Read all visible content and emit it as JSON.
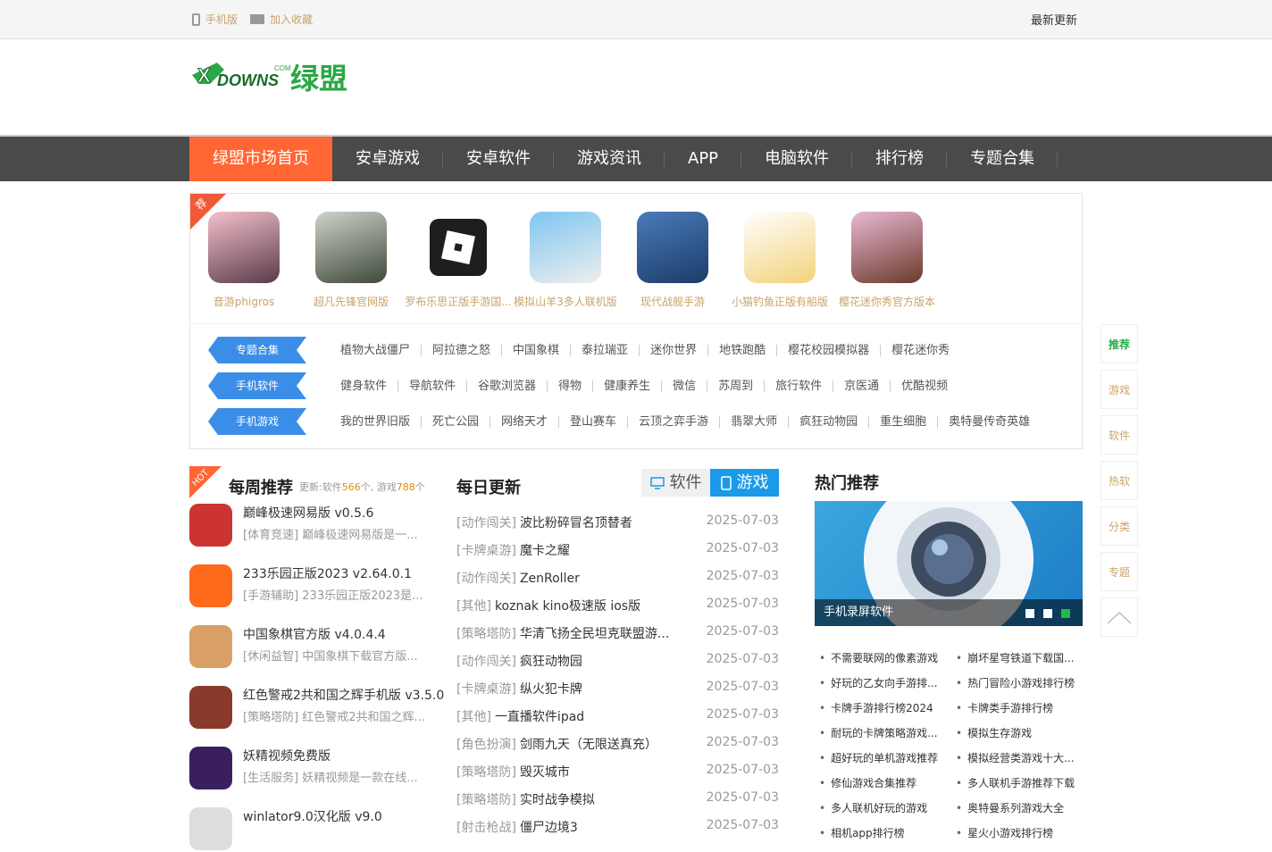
{
  "topbar": {
    "mobile": "手机版",
    "favorite": "加入收藏",
    "latest": "最新更新"
  },
  "logo": {
    "text": "XDOWNS绿盟",
    "com": "COM"
  },
  "nav": [
    "绿盟市场首页",
    "安卓游戏",
    "安卓软件",
    "游戏资讯",
    "APP",
    "电脑软件",
    "排行榜",
    "专题合集"
  ],
  "recommend": {
    "badge": "荐",
    "apps": [
      "音游phigros",
      "超凡先锋官网版",
      "罗布乐思正版手游国...",
      "模拟山羊3多人联机版",
      "现代战舰手游",
      "小猫钓鱼正版有船版",
      "樱花迷你秀官方版本"
    ]
  },
  "tags": [
    {
      "label": "专题合集",
      "links": [
        "植物大战僵尸",
        "阿拉德之怒",
        "中国象棋",
        "泰拉瑞亚",
        "迷你世界",
        "地铁跑酷",
        "樱花校园模拟器",
        "樱花迷你秀"
      ]
    },
    {
      "label": "手机软件",
      "links": [
        "健身软件",
        "导航软件",
        "谷歌浏览器",
        "得物",
        "健康养生",
        "微信",
        "苏周到",
        "旅行软件",
        "京医通",
        "优酷视频"
      ]
    },
    {
      "label": "手机游戏",
      "links": [
        "我的世界旧版",
        "死亡公园",
        "网络天才",
        "登山赛车",
        "云顶之弈手游",
        "翡翠大师",
        "疯狂动物园",
        "重生细胞",
        "奥特曼传奇英雄"
      ]
    }
  ],
  "weekly": {
    "hot": "HOT",
    "title": "每周推荐",
    "sub_prefix": "更新:软件",
    "soft_count": "566",
    "sub_mid": "个, 游戏",
    "game_count": "788",
    "sub_suffix": "个",
    "items": [
      {
        "title": "巅峰极速网易版 v0.5.6",
        "desc": "[体育竞速] 巅峰极速网易版是一..."
      },
      {
        "title": "233乐园正版2023 v2.64.0.1",
        "desc": "[手游辅助] 233乐园正版2023是..."
      },
      {
        "title": "中国象棋官方版 v4.0.4.4",
        "desc": "[休闲益智] 中国象棋下载官方版..."
      },
      {
        "title": "红色警戒2共和国之辉手机版 v3.5.0",
        "desc": "[策略塔防] 红色警戒2共和国之辉..."
      },
      {
        "title": "妖精视频免费版",
        "desc": "[生活服务] 妖精视频是一款在线..."
      },
      {
        "title": "winlator9.0汉化版 v9.0",
        "desc": ""
      }
    ]
  },
  "daily": {
    "title": "每日更新",
    "tabs": [
      "软件",
      "游戏"
    ],
    "rows": [
      {
        "cat": "[动作闯关]",
        "name": "波比粉碎冒名顶替者",
        "date": "2025-07-03"
      },
      {
        "cat": "[卡牌桌游]",
        "name": "魔卡之耀",
        "date": "2025-07-03"
      },
      {
        "cat": "[动作闯关]",
        "name": "ZenRoller",
        "date": "2025-07-03"
      },
      {
        "cat": "[其他]",
        "name": "koznak kino极速版 ios版",
        "date": "2025-07-03"
      },
      {
        "cat": "[策略塔防]",
        "name": "华清飞扬全民坦克联盟游...",
        "date": "2025-07-03"
      },
      {
        "cat": "[动作闯关]",
        "name": "疯狂动物园",
        "date": "2025-07-03"
      },
      {
        "cat": "[卡牌桌游]",
        "name": "纵火犯卡牌",
        "date": "2025-07-03"
      },
      {
        "cat": "[其他]",
        "name": "一直播软件ipad",
        "date": "2025-07-03"
      },
      {
        "cat": "[角色扮演]",
        "name": "剑雨九天（无限送真充）",
        "date": "2025-07-03"
      },
      {
        "cat": "[策略塔防]",
        "name": "毁灭城市",
        "date": "2025-07-03"
      },
      {
        "cat": "[策略塔防]",
        "name": "实时战争模拟",
        "date": "2025-07-03"
      },
      {
        "cat": "[射击枪战]",
        "name": "僵尸边境3",
        "date": "2025-07-03"
      }
    ]
  },
  "hot_rec": {
    "title": "热门推荐",
    "banner_caption": "手机录屏软件",
    "left": [
      "不需要联网的像素游戏",
      "好玩的乙女向手游排...",
      "卡牌手游排行榜2024",
      "耐玩的卡牌策略游戏...",
      "超好玩的单机游戏推荐",
      "修仙游戏合集推荐",
      "多人联机好玩的游戏",
      "相机app排行榜"
    ],
    "right": [
      "崩坏星穹铁道下载国...",
      "热门冒险小游戏排行榜",
      "卡牌类手游排行榜",
      "模拟生存游戏",
      "模拟经营类游戏十大...",
      "多人联机手游推荐下载",
      "奥特曼系列游戏大全",
      "星火小游戏排行榜"
    ]
  },
  "sidebar": [
    "推荐",
    "游戏",
    "软件",
    "热软",
    "分类",
    "专题"
  ]
}
